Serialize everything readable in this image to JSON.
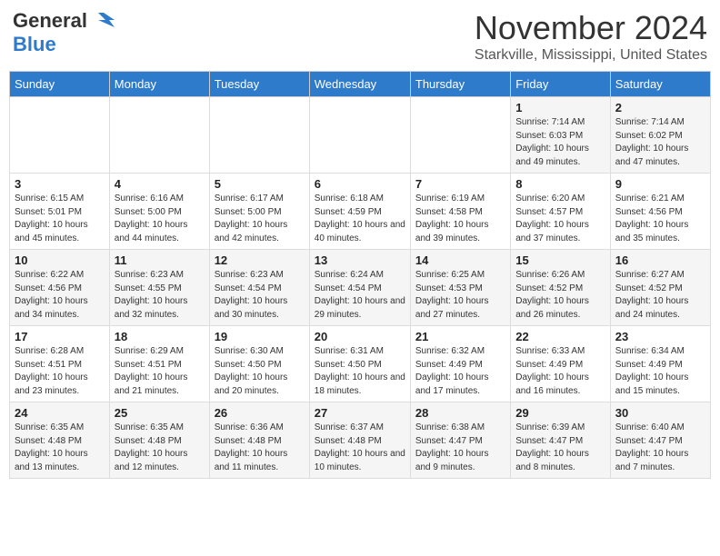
{
  "header": {
    "logo_general": "General",
    "logo_blue": "Blue",
    "month_title": "November 2024",
    "location": "Starkville, Mississippi, United States"
  },
  "weekdays": [
    "Sunday",
    "Monday",
    "Tuesday",
    "Wednesday",
    "Thursday",
    "Friday",
    "Saturday"
  ],
  "weeks": [
    [
      {
        "day": "",
        "info": ""
      },
      {
        "day": "",
        "info": ""
      },
      {
        "day": "",
        "info": ""
      },
      {
        "day": "",
        "info": ""
      },
      {
        "day": "",
        "info": ""
      },
      {
        "day": "1",
        "info": "Sunrise: 7:14 AM\nSunset: 6:03 PM\nDaylight: 10 hours and 49 minutes."
      },
      {
        "day": "2",
        "info": "Sunrise: 7:14 AM\nSunset: 6:02 PM\nDaylight: 10 hours and 47 minutes."
      }
    ],
    [
      {
        "day": "3",
        "info": "Sunrise: 6:15 AM\nSunset: 5:01 PM\nDaylight: 10 hours and 45 minutes."
      },
      {
        "day": "4",
        "info": "Sunrise: 6:16 AM\nSunset: 5:00 PM\nDaylight: 10 hours and 44 minutes."
      },
      {
        "day": "5",
        "info": "Sunrise: 6:17 AM\nSunset: 5:00 PM\nDaylight: 10 hours and 42 minutes."
      },
      {
        "day": "6",
        "info": "Sunrise: 6:18 AM\nSunset: 4:59 PM\nDaylight: 10 hours and 40 minutes."
      },
      {
        "day": "7",
        "info": "Sunrise: 6:19 AM\nSunset: 4:58 PM\nDaylight: 10 hours and 39 minutes."
      },
      {
        "day": "8",
        "info": "Sunrise: 6:20 AM\nSunset: 4:57 PM\nDaylight: 10 hours and 37 minutes."
      },
      {
        "day": "9",
        "info": "Sunrise: 6:21 AM\nSunset: 4:56 PM\nDaylight: 10 hours and 35 minutes."
      }
    ],
    [
      {
        "day": "10",
        "info": "Sunrise: 6:22 AM\nSunset: 4:56 PM\nDaylight: 10 hours and 34 minutes."
      },
      {
        "day": "11",
        "info": "Sunrise: 6:23 AM\nSunset: 4:55 PM\nDaylight: 10 hours and 32 minutes."
      },
      {
        "day": "12",
        "info": "Sunrise: 6:23 AM\nSunset: 4:54 PM\nDaylight: 10 hours and 30 minutes."
      },
      {
        "day": "13",
        "info": "Sunrise: 6:24 AM\nSunset: 4:54 PM\nDaylight: 10 hours and 29 minutes."
      },
      {
        "day": "14",
        "info": "Sunrise: 6:25 AM\nSunset: 4:53 PM\nDaylight: 10 hours and 27 minutes."
      },
      {
        "day": "15",
        "info": "Sunrise: 6:26 AM\nSunset: 4:52 PM\nDaylight: 10 hours and 26 minutes."
      },
      {
        "day": "16",
        "info": "Sunrise: 6:27 AM\nSunset: 4:52 PM\nDaylight: 10 hours and 24 minutes."
      }
    ],
    [
      {
        "day": "17",
        "info": "Sunrise: 6:28 AM\nSunset: 4:51 PM\nDaylight: 10 hours and 23 minutes."
      },
      {
        "day": "18",
        "info": "Sunrise: 6:29 AM\nSunset: 4:51 PM\nDaylight: 10 hours and 21 minutes."
      },
      {
        "day": "19",
        "info": "Sunrise: 6:30 AM\nSunset: 4:50 PM\nDaylight: 10 hours and 20 minutes."
      },
      {
        "day": "20",
        "info": "Sunrise: 6:31 AM\nSunset: 4:50 PM\nDaylight: 10 hours and 18 minutes."
      },
      {
        "day": "21",
        "info": "Sunrise: 6:32 AM\nSunset: 4:49 PM\nDaylight: 10 hours and 17 minutes."
      },
      {
        "day": "22",
        "info": "Sunrise: 6:33 AM\nSunset: 4:49 PM\nDaylight: 10 hours and 16 minutes."
      },
      {
        "day": "23",
        "info": "Sunrise: 6:34 AM\nSunset: 4:49 PM\nDaylight: 10 hours and 15 minutes."
      }
    ],
    [
      {
        "day": "24",
        "info": "Sunrise: 6:35 AM\nSunset: 4:48 PM\nDaylight: 10 hours and 13 minutes."
      },
      {
        "day": "25",
        "info": "Sunrise: 6:35 AM\nSunset: 4:48 PM\nDaylight: 10 hours and 12 minutes."
      },
      {
        "day": "26",
        "info": "Sunrise: 6:36 AM\nSunset: 4:48 PM\nDaylight: 10 hours and 11 minutes."
      },
      {
        "day": "27",
        "info": "Sunrise: 6:37 AM\nSunset: 4:48 PM\nDaylight: 10 hours and 10 minutes."
      },
      {
        "day": "28",
        "info": "Sunrise: 6:38 AM\nSunset: 4:47 PM\nDaylight: 10 hours and 9 minutes."
      },
      {
        "day": "29",
        "info": "Sunrise: 6:39 AM\nSunset: 4:47 PM\nDaylight: 10 hours and 8 minutes."
      },
      {
        "day": "30",
        "info": "Sunrise: 6:40 AM\nSunset: 4:47 PM\nDaylight: 10 hours and 7 minutes."
      }
    ]
  ]
}
